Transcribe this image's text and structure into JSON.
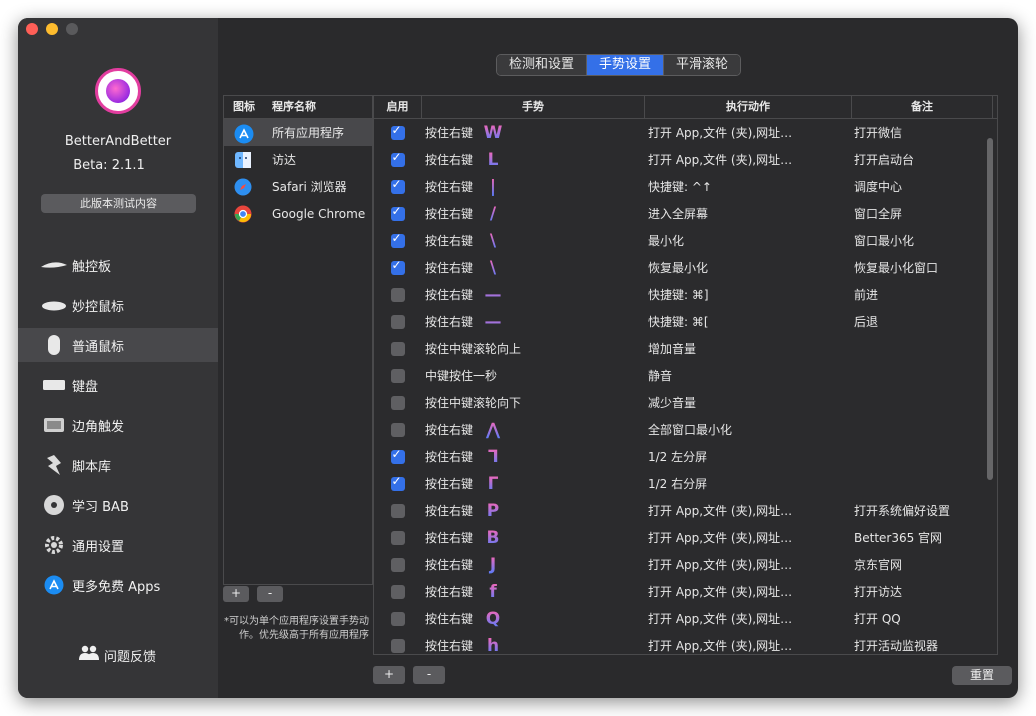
{
  "window": {
    "traffic_colors": [
      "#ff5f57",
      "#febc2e",
      "#5a5a5c"
    ]
  },
  "sidebar": {
    "app_name": "BetterAndBetter",
    "version": "Beta:  2.1.1",
    "beta_button": "此版本测试内容",
    "items": [
      {
        "label": "触控板",
        "icon": "trackpad-icon"
      },
      {
        "label": "妙控鼠标",
        "icon": "magic-mouse-icon"
      },
      {
        "label": "普通鼠标",
        "icon": "mouse-icon",
        "active": true
      },
      {
        "label": "键盘",
        "icon": "keyboard-icon"
      },
      {
        "label": "边角触发",
        "icon": "corner-trigger-icon"
      },
      {
        "label": "脚本库",
        "icon": "script-icon"
      },
      {
        "label": "学习 BAB",
        "icon": "learn-disc-icon"
      },
      {
        "label": "通用设置",
        "icon": "gear-icon"
      },
      {
        "label": "更多免费 Apps",
        "icon": "app-store-icon"
      }
    ],
    "feedback": "问题反馈"
  },
  "tabs": [
    {
      "label": "检测和设置",
      "selected": false
    },
    {
      "label": "手势设置",
      "selected": true
    },
    {
      "label": "平滑滚轮",
      "selected": false
    }
  ],
  "apps_panel": {
    "col_icon": "图标",
    "col_name": "程序名称",
    "apps": [
      {
        "name": "所有应用程序",
        "icon": "app-store-icon",
        "selected": true
      },
      {
        "name": "访达",
        "icon": "finder-icon"
      },
      {
        "name": "Safari 浏览器",
        "icon": "safari-icon"
      },
      {
        "name": "Google Chrome",
        "icon": "chrome-icon"
      }
    ],
    "add": "+",
    "remove": "-",
    "note": "*可以为单个应用程序设置手势动作。优先级高于所有应用程序"
  },
  "table": {
    "col_enable": "启用",
    "col_gesture": "手势",
    "col_action": "执行动作",
    "col_note": "备注",
    "rows": [
      {
        "enabled": true,
        "gesture": "按住右键",
        "glyph": "W",
        "action": "打开 App,文件 (夹),网址…",
        "note": "打开微信"
      },
      {
        "enabled": true,
        "gesture": "按住右键",
        "glyph": "L",
        "action": "打开 App,文件 (夹),网址…",
        "note": "打开启动台"
      },
      {
        "enabled": true,
        "gesture": "按住右键",
        "glyph": "|",
        "action": "快捷键: ^↑",
        "note": "调度中心"
      },
      {
        "enabled": true,
        "gesture": "按住右键",
        "glyph": "/",
        "action": "进入全屏幕",
        "note": "窗口全屏"
      },
      {
        "enabled": true,
        "gesture": "按住右键",
        "glyph": "\\",
        "action": "最小化",
        "note": "窗口最小化"
      },
      {
        "enabled": true,
        "gesture": "按住右键",
        "glyph": "\\",
        "action": "恢复最小化",
        "note": "恢复最小化窗口"
      },
      {
        "enabled": false,
        "gesture": "按住右键",
        "glyph": "—",
        "action": "快捷键: ⌘]",
        "note": "前进"
      },
      {
        "enabled": false,
        "gesture": "按住右键",
        "glyph": "—",
        "action": "快捷键: ⌘[",
        "note": "后退"
      },
      {
        "enabled": false,
        "gesture": "按住中键滚轮向上",
        "glyph": "",
        "action": "增加音量",
        "note": ""
      },
      {
        "enabled": false,
        "gesture": "中键按住一秒",
        "glyph": "",
        "action": "静音",
        "note": ""
      },
      {
        "enabled": false,
        "gesture": "按住中键滚轮向下",
        "glyph": "",
        "action": "减少音量",
        "note": ""
      },
      {
        "enabled": false,
        "gesture": "按住右键",
        "glyph": "⋀",
        "action": "全部窗口最小化",
        "note": ""
      },
      {
        "enabled": true,
        "gesture": "按住右键",
        "glyph": "⅂",
        "action": "1/2 左分屏",
        "note": ""
      },
      {
        "enabled": true,
        "gesture": "按住右键",
        "glyph": "Γ",
        "action": "1/2 右分屏",
        "note": ""
      },
      {
        "enabled": false,
        "gesture": "按住右键",
        "glyph": "P",
        "action": "打开 App,文件 (夹),网址…",
        "note": "打开系统偏好设置"
      },
      {
        "enabled": false,
        "gesture": "按住右键",
        "glyph": "B",
        "action": "打开 App,文件 (夹),网址…",
        "note": "Better365 官网"
      },
      {
        "enabled": false,
        "gesture": "按住右键",
        "glyph": "J",
        "action": "打开 App,文件 (夹),网址…",
        "note": "京东官网"
      },
      {
        "enabled": false,
        "gesture": "按住右键",
        "glyph": "f",
        "action": "打开 App,文件 (夹),网址…",
        "note": "打开访达"
      },
      {
        "enabled": false,
        "gesture": "按住右键",
        "glyph": "Q",
        "action": "打开 App,文件 (夹),网址…",
        "note": "打开 QQ"
      },
      {
        "enabled": false,
        "gesture": "按住右键",
        "glyph": "h",
        "action": "打开 App,文件 (夹),网址…",
        "note": "打开活动监视器"
      }
    ]
  },
  "buttons": {
    "add": "+",
    "remove": "-",
    "reset": "重置"
  },
  "colors": {
    "accent": "#3470e8",
    "glyph_top": "#ff66b3",
    "glyph_bottom": "#4d7dff"
  }
}
